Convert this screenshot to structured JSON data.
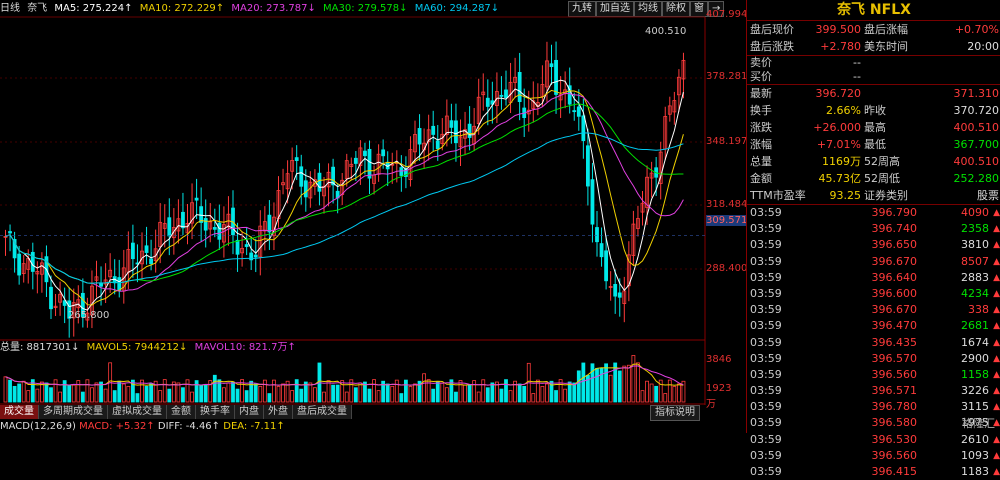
{
  "chart_header": {
    "period": "日线",
    "name": "奈飞",
    "ma5": "MA5: 275.224↑",
    "ma10": "MA10: 272.229↑",
    "ma20": "MA20: 273.787↓",
    "ma30": "MA30: 279.578↓",
    "ma60": "MA60: 294.287↓"
  },
  "toolbar": [
    "九转",
    "加自选",
    "均线",
    "除权",
    "窗",
    "→"
  ],
  "colors": {
    "ma5": "#ffffff",
    "ma10": "#f0d000",
    "ma20": "#e040e0",
    "ma30": "#00e000",
    "ma60": "#00c8f0",
    "up": "#ff3b3b",
    "down": "#00e8e8"
  },
  "price_axis": {
    "labels": [
      "407.994",
      "378.281",
      "348.197",
      "318.484",
      "288.400"
    ],
    "current": "309.571",
    "max_label": "400.510",
    "min_label": "265.800"
  },
  "volume_header": {
    "vol": "总量: 8817301↓",
    "mavol5": "MAVOL5: 7944212↓",
    "mavol10": "MAVOL10: 821.7万↑"
  },
  "volume_axis": [
    "3846",
    "1923",
    "万"
  ],
  "tabs": [
    "成交量",
    "多周期成交量",
    "虚拟成交量",
    "金额",
    "换手率",
    "内盘",
    "外盘",
    "盘后成交量"
  ],
  "help": "指标说明",
  "macd": {
    "label": "MACD(12,26,9)",
    "macd": "MACD: +5.32↑",
    "diff": "DIFF: -4.46↑",
    "dea": "DEA: -7.11↑"
  },
  "quote": {
    "title": "奈飞 NFLX",
    "rows": [
      {
        "l": "盘后现价",
        "v": "399.500",
        "c": "red",
        "l2": "盘后涨幅",
        "v2": "+0.70%",
        "c2": "red"
      },
      {
        "l": "盘后涨跌",
        "v": "+2.780",
        "c": "red",
        "l2": "美东时间",
        "v2": "20:00",
        "c2": "white"
      }
    ],
    "book": [
      {
        "l": "卖价",
        "v": "--"
      },
      {
        "l": "买价",
        "v": "--"
      }
    ],
    "stats": [
      {
        "l": "最新",
        "v": "396.720",
        "c": "red",
        "l2": "",
        "v2": "371.310",
        "c2": "red"
      },
      {
        "l": "换手",
        "v": "2.66%",
        "c": "yellow",
        "l2": "昨收",
        "v2": "370.720",
        "c2": "white"
      },
      {
        "l": "涨跌",
        "v": "+26.000",
        "c": "red",
        "l2": "最高",
        "v2": "400.510",
        "c2": "red"
      },
      {
        "l": "涨幅",
        "v": "+7.01%",
        "c": "red",
        "l2": "最低",
        "v2": "367.700",
        "c2": "green"
      },
      {
        "l": "总量",
        "v": "1169万",
        "c": "yellow",
        "l2": "52周高",
        "v2": "400.510",
        "c2": "red"
      },
      {
        "l": "金额",
        "v": "45.73亿",
        "c": "yellow",
        "l2": "52周低",
        "v2": "252.280",
        "c2": "green"
      },
      {
        "l": "TTM市盈率",
        "v": "93.25",
        "c": "yellow",
        "l2": "证券类别",
        "v2": "股票",
        "c2": "white"
      }
    ],
    "ticks": [
      {
        "t": "03:59",
        "p": "396.790",
        "q": "4090",
        "c": "red",
        "a": "up"
      },
      {
        "t": "03:59",
        "p": "396.740",
        "q": "2358",
        "c": "green",
        "a": "up"
      },
      {
        "t": "03:59",
        "p": "396.650",
        "q": "3810",
        "c": "white",
        "a": "up"
      },
      {
        "t": "03:59",
        "p": "396.670",
        "q": "8507",
        "c": "red",
        "a": "up"
      },
      {
        "t": "03:59",
        "p": "396.640",
        "q": "2883",
        "c": "white",
        "a": "up"
      },
      {
        "t": "03:59",
        "p": "396.600",
        "q": "4234",
        "c": "green",
        "a": "up"
      },
      {
        "t": "03:59",
        "p": "396.670",
        "q": "338",
        "c": "red",
        "a": "up"
      },
      {
        "t": "03:59",
        "p": "396.470",
        "q": "2681",
        "c": "green",
        "a": "up"
      },
      {
        "t": "03:59",
        "p": "396.435",
        "q": "1674",
        "c": "white",
        "a": "up"
      },
      {
        "t": "03:59",
        "p": "396.570",
        "q": "2900",
        "c": "white",
        "a": "up"
      },
      {
        "t": "03:59",
        "p": "396.560",
        "q": "1158",
        "c": "green",
        "a": "up"
      },
      {
        "t": "03:59",
        "p": "396.571",
        "q": "3226",
        "c": "white",
        "a": "up"
      },
      {
        "t": "03:59",
        "p": "396.780",
        "q": "3115",
        "c": "white",
        "a": "up"
      },
      {
        "t": "03:59",
        "p": "396.580",
        "q": "1975",
        "c": "white",
        "a": "up"
      },
      {
        "t": "03:59",
        "p": "396.530",
        "q": "2610",
        "c": "white",
        "a": "up"
      },
      {
        "t": "03:59",
        "p": "396.560",
        "q": "1093",
        "c": "white",
        "a": "up"
      },
      {
        "t": "03:59",
        "p": "396.415",
        "q": "1183",
        "c": "white",
        "a": "up"
      }
    ]
  },
  "watermark": "格隆汇"
}
